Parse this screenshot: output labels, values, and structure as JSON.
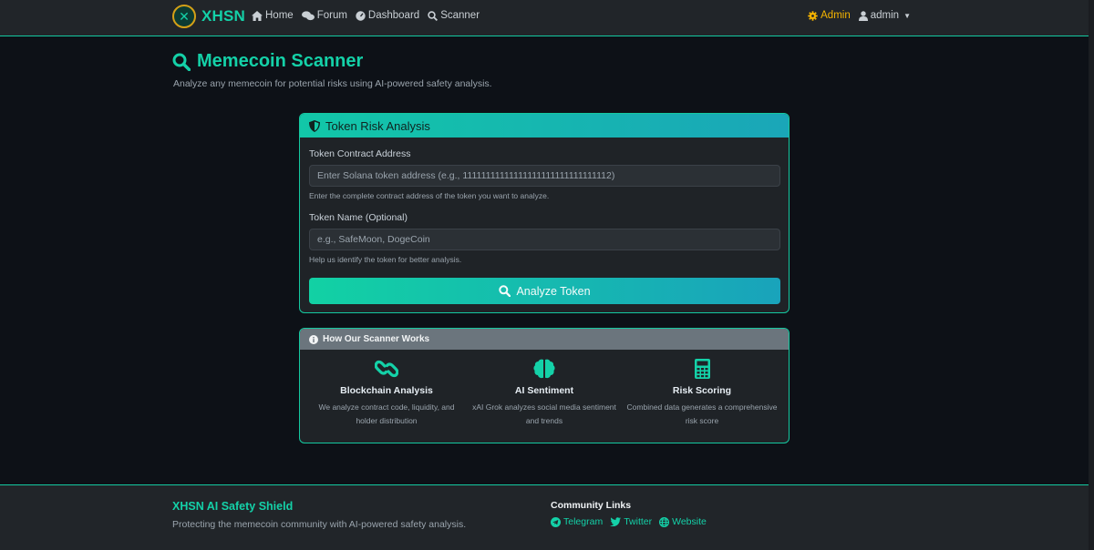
{
  "navbar": {
    "brand": "XHSN",
    "links": [
      {
        "label": "Home",
        "icon": "home-icon"
      },
      {
        "label": "Forum",
        "icon": "comments-icon"
      },
      {
        "label": "Dashboard",
        "icon": "gauge-icon"
      },
      {
        "label": "Scanner",
        "icon": "search-icon"
      }
    ],
    "admin_label": "Admin",
    "user_label": "admin"
  },
  "header": {
    "title": "Memecoin Scanner",
    "subtitle": "Analyze any memecoin for potential risks using AI-powered safety analysis."
  },
  "risk_card": {
    "title": "Token Risk Analysis",
    "address_label": "Token Contract Address",
    "address_placeholder": "Enter Solana token address (e.g., 11111111111111111111111111111112)",
    "address_help": "Enter the complete contract address of the token you want to analyze.",
    "name_label": "Token Name (Optional)",
    "name_placeholder": "e.g., SafeMoon, DogeCoin",
    "name_help": "Help us identify the token for better analysis.",
    "button_label": "Analyze Token"
  },
  "how_card": {
    "title": "How Our Scanner Works",
    "features": [
      {
        "title": "Blockchain Analysis",
        "desc": "We analyze contract code, liquidity, and holder distribution",
        "icon": "link-icon"
      },
      {
        "title": "AI Sentiment",
        "desc": "xAI Grok analyzes social media sentiment and trends",
        "icon": "brain-icon"
      },
      {
        "title": "Risk Scoring",
        "desc": "Combined data generates a comprehensive risk score",
        "icon": "calculator-icon"
      }
    ]
  },
  "footer": {
    "brand": "XHSN AI Safety Shield",
    "tagline": "Protecting the memecoin community with AI-powered safety analysis.",
    "community_title": "Community Links",
    "links": [
      {
        "label": "Telegram",
        "icon": "telegram-icon"
      },
      {
        "label": "Twitter",
        "icon": "twitter-icon"
      },
      {
        "label": "Website",
        "icon": "globe-icon"
      }
    ]
  },
  "colors": {
    "accent": "#14d1a8",
    "background": "#0d1117",
    "panel": "#212529",
    "admin": "#f5b400"
  }
}
